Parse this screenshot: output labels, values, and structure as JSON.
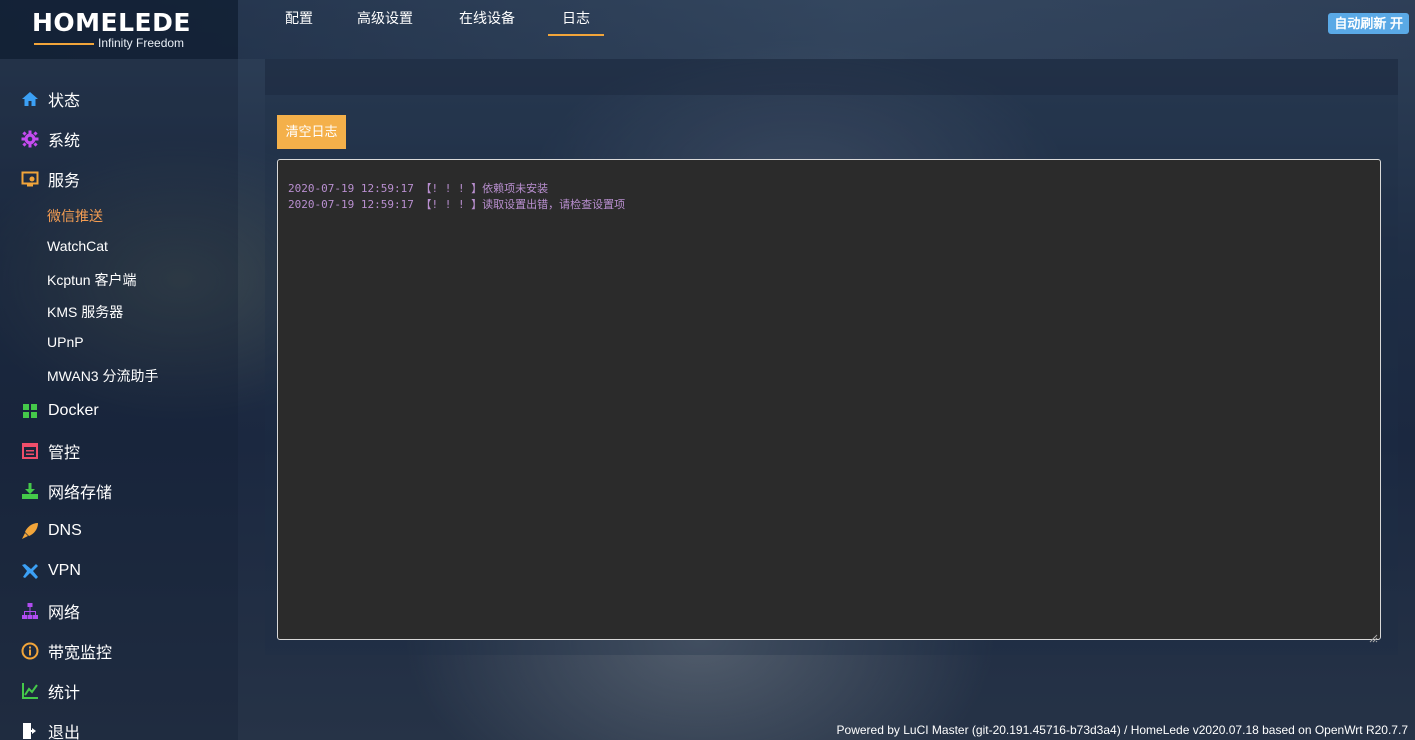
{
  "header": {
    "logo_title": "HOMELEDE",
    "logo_subtitle": "Infinity Freedom",
    "refresh_button": "自动刷新 开"
  },
  "sidebar": {
    "items": [
      {
        "label": "状态",
        "icon": "home-icon",
        "color": "#3ba0f5"
      },
      {
        "label": "系统",
        "icon": "gear-icon",
        "color": "#c54bf0"
      },
      {
        "label": "服务",
        "icon": "services-icon",
        "color": "#f2a53a"
      },
      {
        "label": "Docker",
        "icon": "docker-grid-icon",
        "color": "#45c94a"
      },
      {
        "label": "管控",
        "icon": "control-panel-icon",
        "color": "#ee4e6a"
      },
      {
        "label": "网络存储",
        "icon": "download-storage-icon",
        "color": "#45c94a"
      },
      {
        "label": "DNS",
        "icon": "rocket-icon",
        "color": "#f2a53a"
      },
      {
        "label": "VPN",
        "icon": "airplane-icon",
        "color": "#3ba0f5"
      },
      {
        "label": "网络",
        "icon": "network-tree-icon",
        "color": "#b04cf0"
      },
      {
        "label": "带宽监控",
        "icon": "info-circle-icon",
        "color": "#f2a53a"
      },
      {
        "label": "统计",
        "icon": "line-chart-icon",
        "color": "#45c94a"
      },
      {
        "label": "退出",
        "icon": "logout-icon",
        "color": "#ffffff"
      }
    ],
    "sub_items": [
      {
        "label": "微信推送",
        "active": true
      },
      {
        "label": "WatchCat",
        "active": false
      },
      {
        "label": "Kcptun 客户端",
        "active": false
      },
      {
        "label": "KMS 服务器",
        "active": false
      },
      {
        "label": "UPnP",
        "active": false
      },
      {
        "label": "MWAN3 分流助手",
        "active": false
      }
    ]
  },
  "tabs": [
    {
      "label": "配置",
      "active": false
    },
    {
      "label": "高级设置",
      "active": false
    },
    {
      "label": "在线设备",
      "active": false
    },
    {
      "label": "日志",
      "active": true
    }
  ],
  "main": {
    "clear_button": "清空日志",
    "log_lines": [
      "2020-07-19 12:59:17 【! ! ! 】依赖项未安装",
      "2020-07-19 12:59:17 【! ! ! 】读取设置出错，请检查设置项"
    ]
  },
  "footer": {
    "text": "Powered by LuCI Master (git-20.191.45716-b73d3a4) / HomeLede v2020.07.18 based on OpenWrt R20.7.7"
  },
  "colors": {
    "accent_orange": "#f2a53a",
    "active_link": "#f39c52",
    "refresh_blue": "#5aa9e6",
    "log_text": "#b98fd0"
  }
}
